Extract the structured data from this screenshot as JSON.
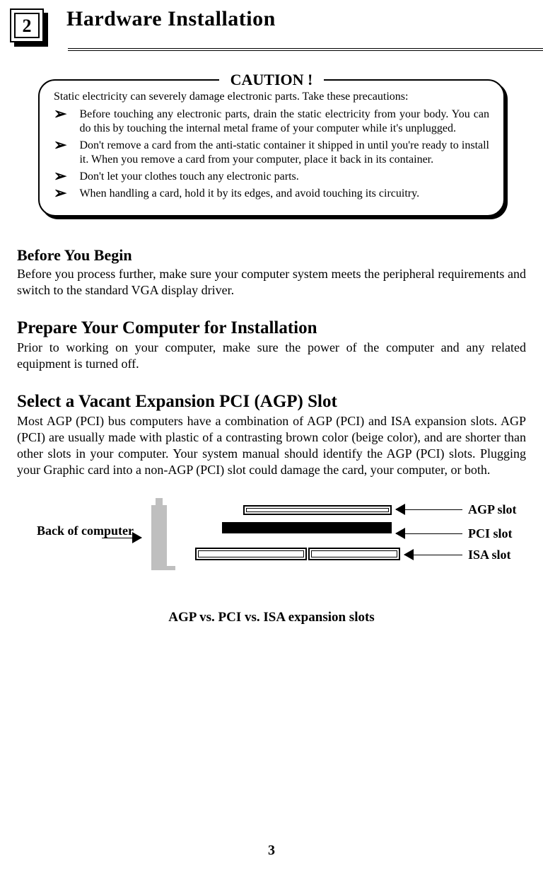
{
  "chapter": {
    "number": "2",
    "title": "Hardware Installation"
  },
  "caution": {
    "title": "CAUTION !",
    "intro": "Static electricity can severely damage electronic parts.  Take these precautions:",
    "items": [
      "Before touching any electronic parts, drain the static electricity from your body.  You can do this by touching the internal metal frame of your computer while it's unplugged.",
      "Don't remove a card from the anti-static container it shipped in until you're ready to install it.  When you remove a card from your computer, place it back in its container.",
      "Don't let your clothes touch any electronic parts.",
      "When handling a card, hold it by its edges, and avoid touching its circuitry."
    ]
  },
  "sections": {
    "before": {
      "heading": "Before You Begin",
      "body": "Before you process further, make sure your computer system meets the peripheral requirements and switch to the standard VGA display driver."
    },
    "prepare": {
      "heading": "Prepare Your Computer for Installation",
      "body": "Prior to working on your computer, make sure the power of the computer and any related equipment is turned off."
    },
    "select": {
      "heading": "Select a Vacant Expansion PCI (AGP) Slot",
      "body": "Most AGP (PCI) bus computers have a combination of AGP (PCI) and ISA expansion slots.  AGP (PCI) are usually made with plastic of a contrasting brown color (beige color), and are shorter than other slots in your computer.  Your system manual should identify the AGP (PCI) slots.  Plugging your Graphic card into a non-AGP (PCI) slot could damage the card, your computer, or both."
    }
  },
  "diagram": {
    "labels": {
      "back": "Back of computer",
      "agp": "AGP slot",
      "pci": "PCI slot",
      "isa": "ISA slot"
    },
    "caption": "AGP vs. PCI vs. ISA expansion slots"
  },
  "page_number": "3"
}
